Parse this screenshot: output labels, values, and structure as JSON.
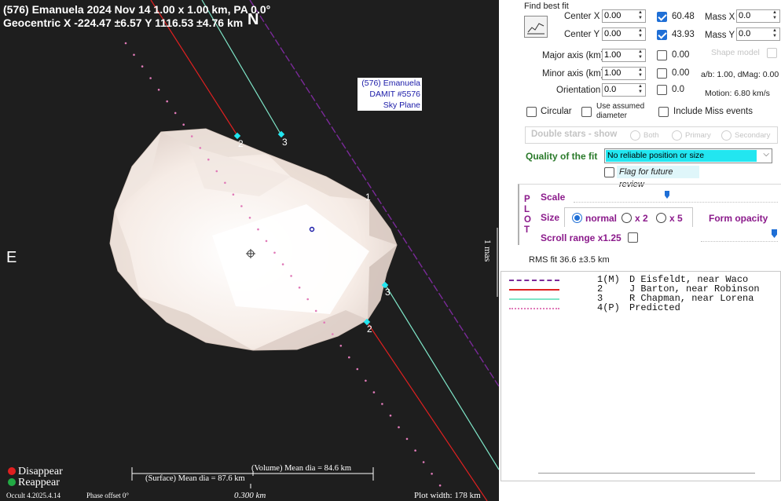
{
  "header": {
    "line1": "(576) Emanuela  2024 Nov 14   1.00 x 1.00 km,  PA 0.0°",
    "line2": "Geocentric  X  -224.47 ±6.57  Y 1116.53 ±4.76 km",
    "north_label": "N",
    "east_label": "E"
  },
  "model_box": {
    "line1": "(576) Emanuela",
    "line2": "DAMIT #5576",
    "line3": "Sky Plane"
  },
  "chord_labels": {
    "c1_top": "1",
    "c2_top": "2",
    "c3_top": "3",
    "c3_bottom": "3",
    "c2_bottom": "2"
  },
  "right_axis_label": "1 mas",
  "bottom": {
    "disappear": "Disappear",
    "reappear": "Reappear",
    "volume_dia": "(Volume) Mean dia = 84.6 km",
    "surface_dia": "(Surface) Mean dia = 87.6 km",
    "version": "Occult 4.2025.4.14",
    "phase_offset": "Phase offset 0°",
    "scale_value": "0.300 km",
    "plot_width": "Plot width: 178 km",
    "disappear_color": "#e02020",
    "reappear_color": "#22aa44"
  },
  "panel": {
    "find_best_fit": "Find best fit",
    "center_x_label": "Center X",
    "center_x_value": "0.00",
    "center_x_fit": "60.48",
    "center_y_label": "Center Y",
    "center_y_value": "0.00",
    "center_y_fit": "43.93",
    "mass_x_label": "Mass X",
    "mass_x_value": "0.0",
    "mass_y_label": "Mass Y",
    "mass_y_value": "0.0",
    "major_label": "Major axis (km)",
    "major_value": "1.00",
    "major_fit": "0.00",
    "shape_model_label": "Shape model",
    "minor_label": "Minor axis (km)",
    "minor_value": "1.00",
    "minor_fit": "0.00",
    "ab_text": "a/b: 1.00, dMag: 0.00",
    "orientation_label": "Orientation",
    "orientation_value": "0.0",
    "orientation_fit": "0.0",
    "motion_text": "Motion: 6.80 km/s",
    "circular_label": "Circular",
    "use_assumed_label_1": "Use assumed",
    "use_assumed_label_2": "diameter",
    "include_miss_label": "Include Miss events",
    "double_stars_label": "Double stars - show",
    "both_label": "Both",
    "primary_label": "Primary",
    "secondary_label": "Secondary",
    "quality_label": "Quality of the fit",
    "quality_value": "No reliable position or size",
    "flag_review_label": "Flag for future review",
    "plot_vertical": [
      "P",
      "L",
      "O",
      "T"
    ],
    "scale_label": "Scale",
    "size_label": "Size",
    "size_normal": "normal",
    "size_x2": "x 2",
    "size_x5": "x 5",
    "form_opacity_label": "Form opacity",
    "scroll_range_label": "Scroll range x1.25",
    "rms_fit": "RMS fit 36.6 ±3.5 km"
  },
  "observers": [
    {
      "num": "1(M)",
      "name": "D Eisfeldt, near Waco",
      "color": "#7b2a9a",
      "style": "dash"
    },
    {
      "num": "2",
      "name": "J Barton, near Robinson",
      "color": "#e02020",
      "style": "solid"
    },
    {
      "num": "3",
      "name": "R Chapman, near Lorena",
      "color": "#7fe6c8",
      "style": "solid"
    },
    {
      "num": "4(P)",
      "name": "Predicted",
      "color": "#e07ab8",
      "style": "dots"
    }
  ],
  "colors": {
    "plot_bg": "#1e1e1e",
    "asteroid_light": "#fff4ee",
    "asteroid_shade": "#e2d4cc",
    "chord1": "#7b2a9a",
    "chord2": "#e02020",
    "chord3": "#7fe6c8",
    "predicted": "#e07ab8",
    "event_marker": "#22e6f0",
    "quality_bg": "#22e6f0"
  }
}
